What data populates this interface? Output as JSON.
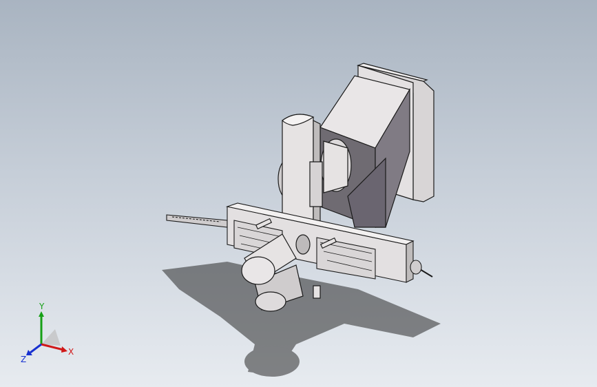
{
  "viewport": {
    "background_top": "#a9b4c1",
    "background_bottom": "#e7ebf0"
  },
  "model": {
    "part_fill": "#e6e3e3",
    "part_shade": "#bfbcbc",
    "part_dark": "#6f6b72",
    "edge_color": "#1a1a1a",
    "shadow_color": "#2c2c2c"
  },
  "triad": {
    "x_label": "X",
    "y_label": "Y",
    "z_label": "Z",
    "x_color": "#d01818",
    "y_color": "#16a016",
    "z_color": "#1730d0"
  }
}
